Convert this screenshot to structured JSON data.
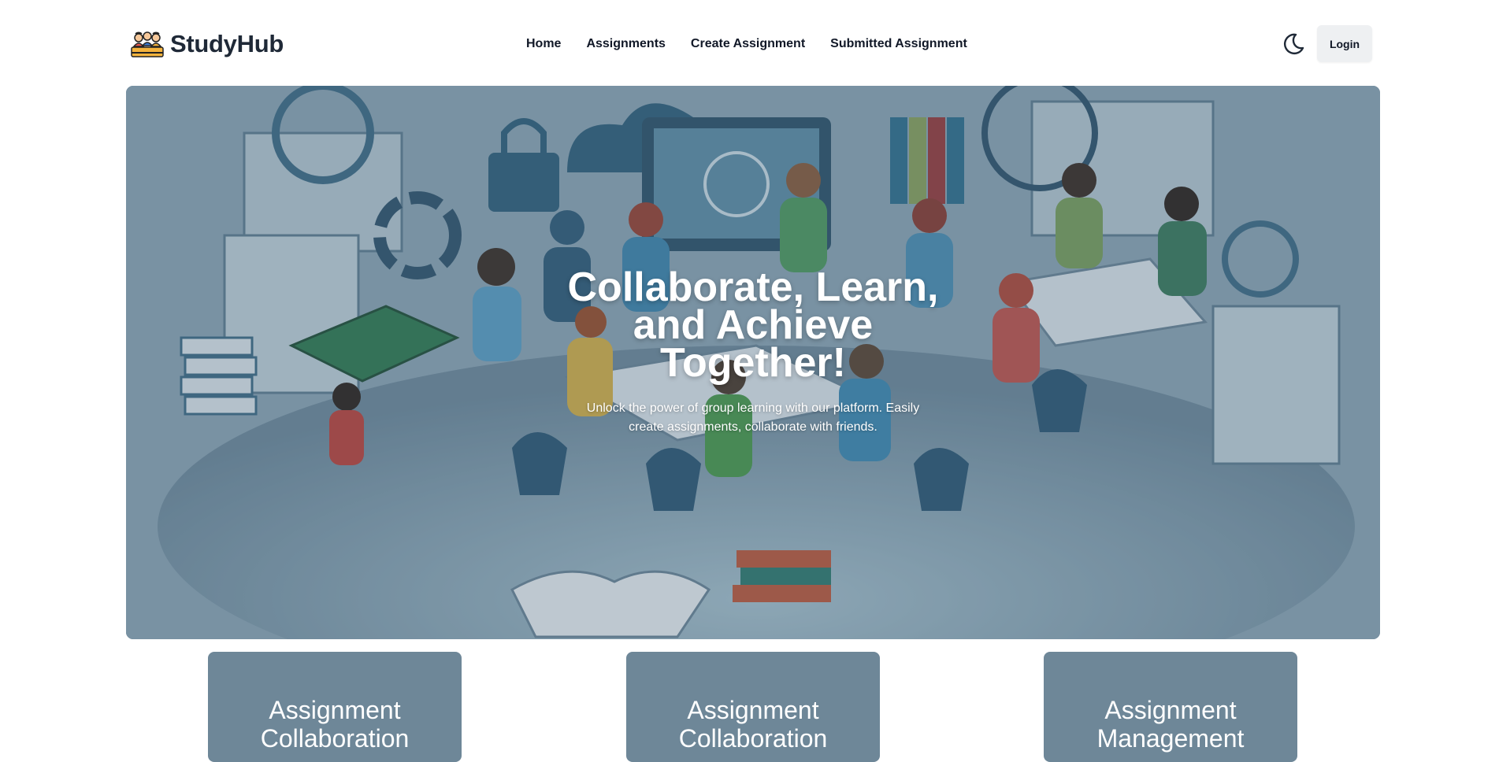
{
  "brand": {
    "name": "StudyHub",
    "logo_icon": "students-group-icon"
  },
  "nav": {
    "links": [
      {
        "label": "Home"
      },
      {
        "label": "Assignments"
      },
      {
        "label": "Create Assignment"
      },
      {
        "label": "Submitted Assignment"
      }
    ],
    "theme_toggle_icon": "moon-icon",
    "login_label": "Login"
  },
  "hero": {
    "title": "Collaborate, Learn, and Achieve Together!",
    "subtitle": "Unlock the power of group learning with our platform. Easily create assignments, collaborate with friends.",
    "image": "students-collaborating-illustration"
  },
  "features": {
    "cards": [
      {
        "title": "Assignment Collaboration"
      },
      {
        "title": "Assignment Collaboration"
      },
      {
        "title": "Assignment Management"
      }
    ]
  },
  "colors": {
    "hero_tint": "#5f7a8d",
    "card_bg": "#6e8798",
    "nav_text": "#111827",
    "login_bg": "#eef0f2"
  }
}
